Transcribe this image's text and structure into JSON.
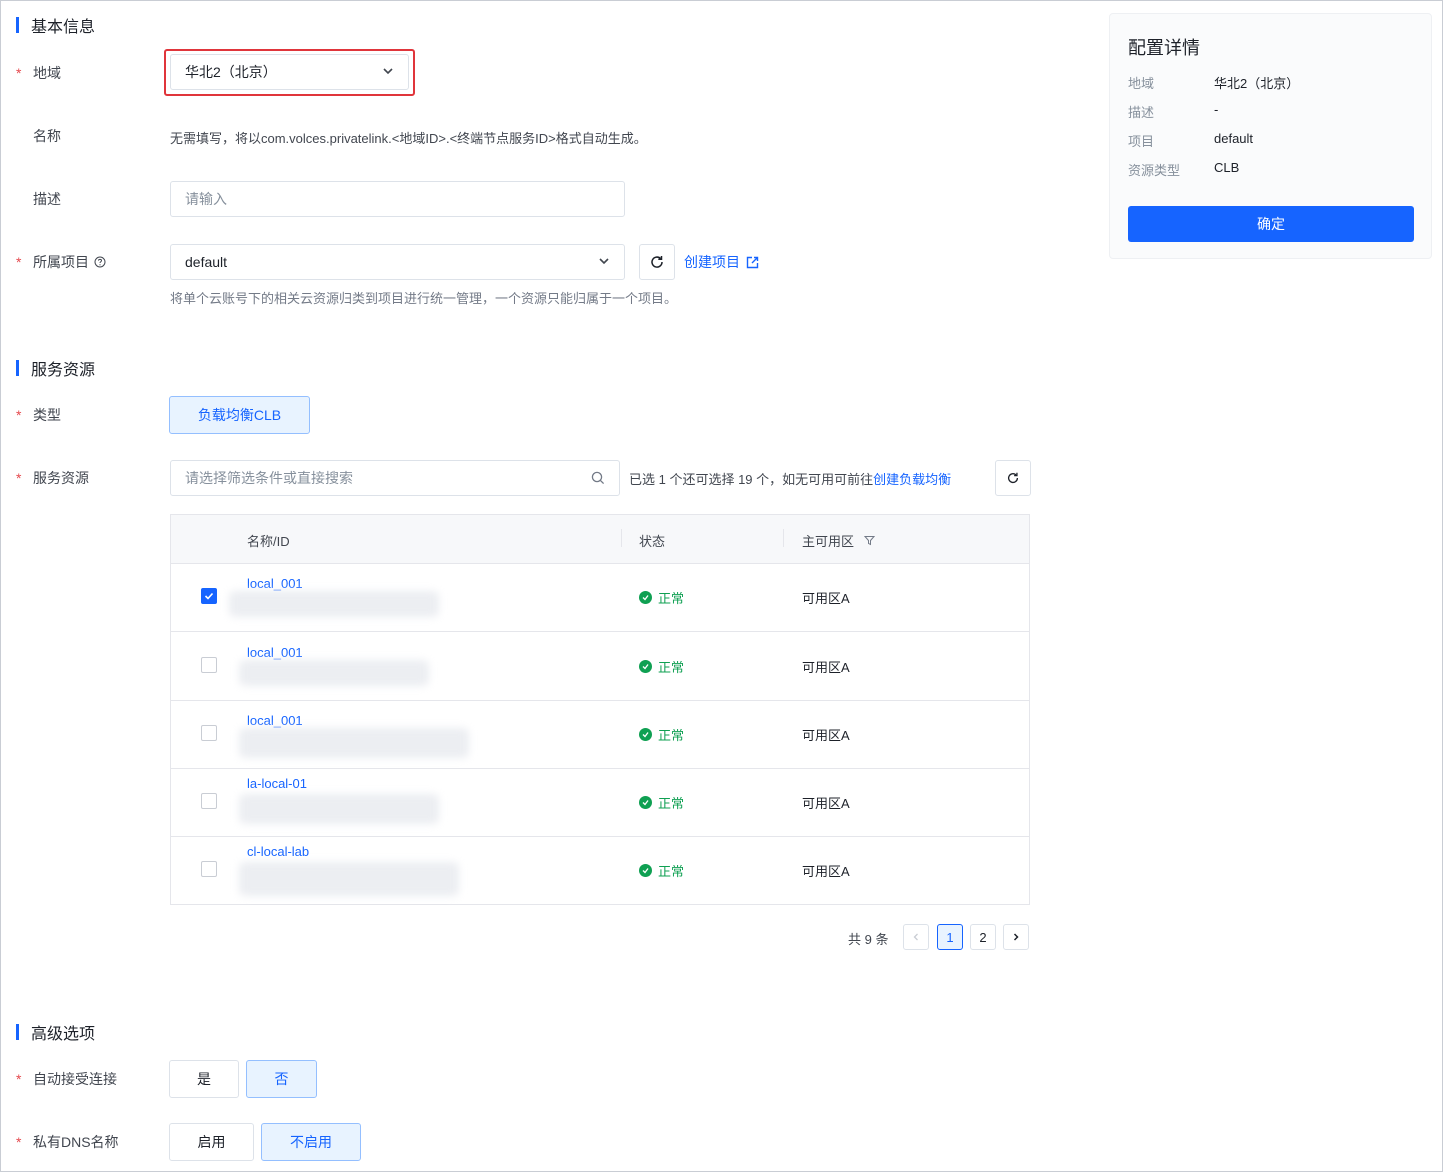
{
  "basic": {
    "title": "基本信息",
    "region_label": "地域",
    "region_value": "华北2（北京）",
    "name_label": "名称",
    "name_hint": "无需填写，将以com.volces.privatelink.<地域ID>.<终端节点服务ID>格式自动生成。",
    "desc_label": "描述",
    "desc_placeholder": "请输入",
    "project_label": "所属项目",
    "project_value": "default",
    "create_project_link": "创建项目",
    "project_hint": "将单个云账号下的相关云资源归类到项目进行统一管理，一个资源只能归属于一个项目。"
  },
  "service": {
    "title": "服务资源",
    "type_label": "类型",
    "type_option": "负载均衡CLB",
    "resource_label": "服务资源",
    "search_placeholder": "请选择筛选条件或直接搜索",
    "selection_text": "已选 1 个还可选择 19 个，如无可用可前往",
    "create_clb_link": "创建负载均衡",
    "table": {
      "col_name": "名称/ID",
      "col_status": "状态",
      "col_zone": "主可用区",
      "rows": [
        {
          "name": "local_001",
          "status": "正常",
          "zone": "可用区A",
          "checked": true
        },
        {
          "name": "local_001",
          "status": "正常",
          "zone": "可用区A",
          "checked": false
        },
        {
          "name": "local_001",
          "status": "正常",
          "zone": "可用区A",
          "checked": false
        },
        {
          "name": "la-local-01",
          "status": "正常",
          "zone": "可用区A",
          "checked": false
        },
        {
          "name": "cl-local-lab",
          "status": "正常",
          "zone": "可用区A",
          "checked": false
        }
      ]
    },
    "pagination": {
      "total_text": "共 9 条",
      "pages": [
        "1",
        "2"
      ],
      "current": "1"
    }
  },
  "advanced": {
    "title": "高级选项",
    "auto_accept_label": "自动接受连接",
    "auto_accept_yes": "是",
    "auto_accept_no": "否",
    "dns_label": "私有DNS名称",
    "dns_enable": "启用",
    "dns_disable": "不启用"
  },
  "summary": {
    "title": "配置详情",
    "region_key": "地域",
    "region_val": "华北2（北京）",
    "desc_key": "描述",
    "desc_val": "-",
    "project_key": "项目",
    "project_val": "default",
    "type_key": "资源类型",
    "type_val": "CLB",
    "confirm_label": "确定"
  },
  "colors": {
    "accent": "#1664ff",
    "success": "#0fa052",
    "required": "#e5484d",
    "highlight_border": "#e0353b"
  },
  "icons": [
    "chevron-down-icon",
    "help-circle-icon",
    "refresh-icon",
    "external-link-icon",
    "search-icon",
    "filter-icon",
    "check-icon",
    "chevron-left-icon",
    "chevron-right-icon"
  ]
}
